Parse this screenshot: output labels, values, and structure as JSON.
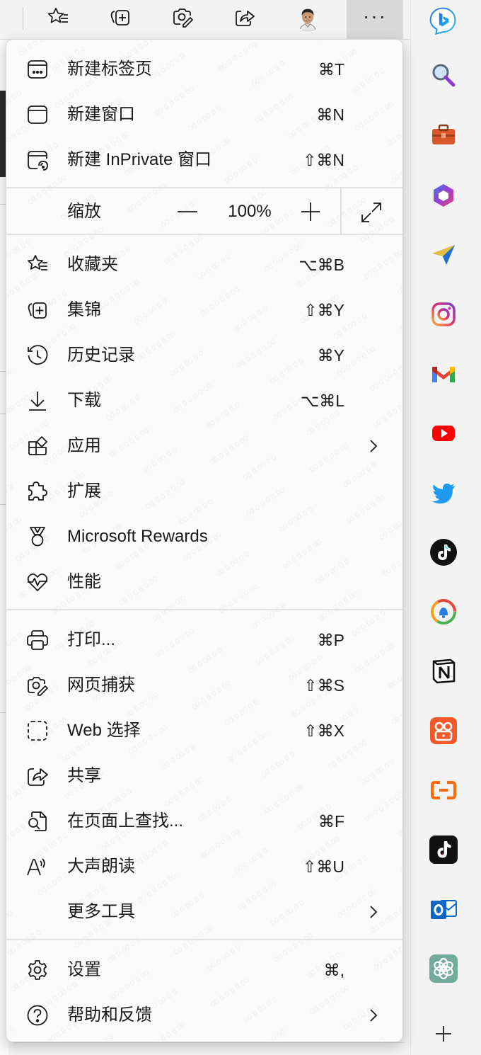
{
  "toolbar": {
    "buttons": [
      {
        "icon": "favorites-icon"
      },
      {
        "icon": "collections-icon"
      },
      {
        "icon": "web-capture-icon"
      },
      {
        "icon": "share-icon"
      },
      {
        "icon": "profile-avatar"
      }
    ],
    "more_label": "···"
  },
  "menu": {
    "new_tab": {
      "label": "新建标签页",
      "shortcut": "⌘T"
    },
    "new_window": {
      "label": "新建窗口",
      "shortcut": "⌘N"
    },
    "new_inprivate": {
      "label": "新建 InPrivate 窗口",
      "shortcut": "⇧⌘N"
    },
    "zoom": {
      "label": "缩放",
      "minus": "—",
      "value": "100%",
      "plus": "+"
    },
    "favorites": {
      "label": "收藏夹",
      "shortcut": "⌥⌘B"
    },
    "collections": {
      "label": "集锦",
      "shortcut": "⇧⌘Y"
    },
    "history": {
      "label": "历史记录",
      "shortcut": "⌘Y"
    },
    "downloads": {
      "label": "下载",
      "shortcut": "⌥⌘L"
    },
    "apps": {
      "label": "应用"
    },
    "extensions": {
      "label": "扩展"
    },
    "rewards": {
      "label": "Microsoft Rewards"
    },
    "performance": {
      "label": "性能"
    },
    "print": {
      "label": "打印...",
      "shortcut": "⌘P"
    },
    "web_capture": {
      "label": "网页捕获",
      "shortcut": "⇧⌘S"
    },
    "web_select": {
      "label": "Web 选择",
      "shortcut": "⇧⌘X"
    },
    "share": {
      "label": "共享"
    },
    "find": {
      "label": "在页面上查找...",
      "shortcut": "⌘F"
    },
    "read_aloud": {
      "label": "大声朗读",
      "shortcut": "⇧⌘U"
    },
    "more_tools": {
      "label": "更多工具"
    },
    "settings": {
      "label": "设置",
      "shortcut": "⌘,"
    },
    "help": {
      "label": "帮助和反馈"
    }
  },
  "sidebar": {
    "items": [
      "bing-icon",
      "search-icon",
      "tools-icon",
      "office-icon",
      "send-icon",
      "instagram-icon",
      "gmail-icon",
      "youtube-icon",
      "twitter-icon",
      "tiktok-icon",
      "chat-bell-icon",
      "notion-icon",
      "video-icon",
      "aliyun-icon",
      "tiktok-icon",
      "outlook-icon",
      "chatgpt-icon",
      "add-icon"
    ],
    "add_label": "+"
  },
  "colors": {
    "menu_bg": "#fbfbfb",
    "toolbar_bg": "#f3f3f3",
    "more_active_bg": "#d9d9d9",
    "divider": "#e2e2e2"
  }
}
